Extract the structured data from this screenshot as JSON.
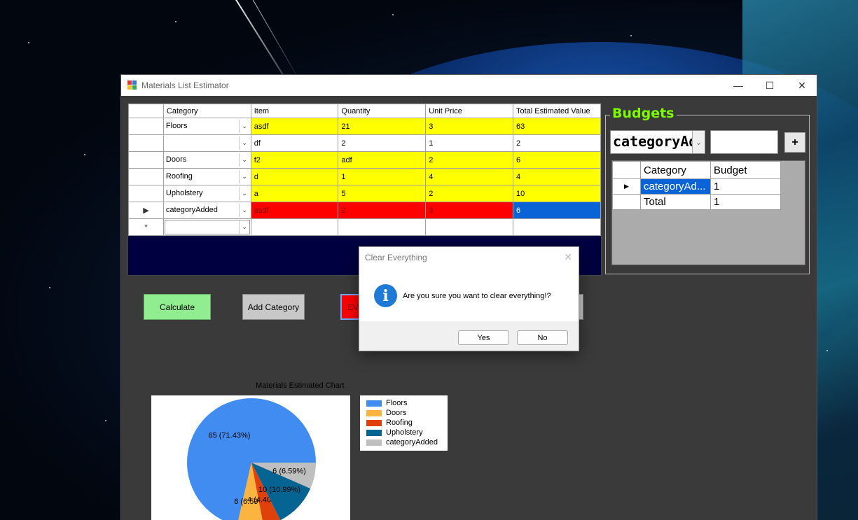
{
  "window": {
    "title": "Materials List Estimator"
  },
  "grid": {
    "columns": [
      "Category",
      "Item",
      "Quantity",
      "Unit Price",
      "Total Estimated Value"
    ],
    "rows": [
      {
        "category": "Floors",
        "item": "asdf",
        "quantity": "21",
        "unit_price": "3",
        "total": "63",
        "style": "yellow"
      },
      {
        "category": "",
        "item": "df",
        "quantity": "2",
        "unit_price": "1",
        "total": "2",
        "style": "white"
      },
      {
        "category": "Doors",
        "item": "f2",
        "quantity": "adf",
        "unit_price": "2",
        "total": "6",
        "style": "yellow"
      },
      {
        "category": "Roofing",
        "item": "d",
        "quantity": "1",
        "unit_price": "4",
        "total": "4",
        "style": "yellow"
      },
      {
        "category": "Upholstery",
        "item": "a",
        "quantity": "5",
        "unit_price": "2",
        "total": "10",
        "style": "yellow"
      },
      {
        "category": "categoryAdded",
        "item": "asdf",
        "quantity": "2",
        "unit_price": "3",
        "total": "6",
        "style": "red"
      }
    ],
    "current_row_marker": "▶",
    "new_row_marker": "*"
  },
  "budgets": {
    "title": "Budgets",
    "combo_value": "categoryAdded",
    "input_value": "",
    "add_label": "+",
    "columns": [
      "Category",
      "Budget"
    ],
    "rows": [
      {
        "category": "categoryAd...",
        "budget": "1"
      },
      {
        "category": "Total",
        "budget": "1"
      }
    ]
  },
  "buttons": {
    "calculate": "Calculate",
    "add_category": "Add Category",
    "clear_partial": "EVE"
  },
  "chart_data": {
    "type": "pie",
    "title": "Materials Estimated Chart",
    "categories": [
      "Floors",
      "Doors",
      "Roofing",
      "Upholstery",
      "categoryAdded"
    ],
    "values": [
      65,
      6,
      4,
      10,
      6
    ],
    "labels": [
      "65 (71.43%)",
      "6 (6.59%)",
      "4 (4.40%)",
      "10 (10.99%)",
      "6 (6.59%)"
    ],
    "colors": [
      "#418cf0",
      "#fcb441",
      "#e0400a",
      "#056492",
      "#bfbfbf"
    ],
    "legend": "right"
  },
  "dialog": {
    "title": "Clear Everything",
    "message": "Are you sure you want to clear everything!?",
    "yes": "Yes",
    "no": "No"
  }
}
